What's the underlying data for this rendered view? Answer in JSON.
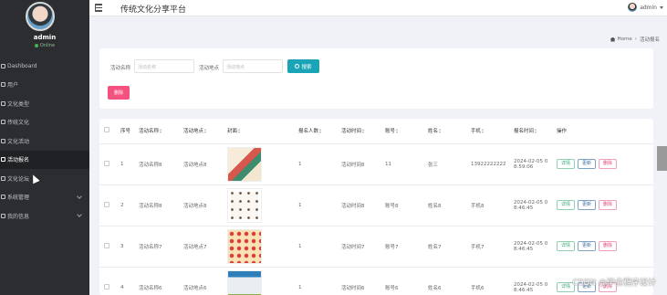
{
  "app_title": "传统文化分享平台",
  "sidebar": {
    "username": "admin",
    "status": "Online",
    "items": [
      {
        "label": "Dashboard",
        "active": false,
        "expandable": false
      },
      {
        "label": "用户",
        "active": false,
        "expandable": false
      },
      {
        "label": "文化类型",
        "active": false,
        "expandable": false
      },
      {
        "label": "传统文化",
        "active": false,
        "expandable": false
      },
      {
        "label": "文化活动",
        "active": false,
        "expandable": false
      },
      {
        "label": "活动报名",
        "active": true,
        "expandable": false
      },
      {
        "label": "文化论坛",
        "active": false,
        "expandable": false
      },
      {
        "label": "系统管理",
        "active": false,
        "expandable": true
      },
      {
        "label": "我的信息",
        "active": false,
        "expandable": true
      }
    ]
  },
  "topbar": {
    "username": "admin"
  },
  "breadcrumb": {
    "home": "Home",
    "current": "活动报名"
  },
  "search": {
    "field1_label": "活动名称",
    "field1_placeholder": "活动名称",
    "field2_label": "活动地点",
    "field2_placeholder": "活动地点",
    "search_label": "搜索",
    "delete_label": "删除"
  },
  "table": {
    "columns": [
      "序号",
      "活动名称",
      "活动地点",
      "封面",
      "报名人数",
      "活动时间",
      "账号",
      "姓名",
      "手机",
      "报名时间",
      "操作"
    ],
    "rows": [
      {
        "index": "1",
        "name": "活动名称8",
        "place": "活动地点8",
        "count": "1",
        "time": "活动时间8",
        "account": "11",
        "person": "张三",
        "phone": "13922222222",
        "signup_l1": "2024-02-05 0",
        "signup_l2": "8:59:06"
      },
      {
        "index": "2",
        "name": "活动名称8",
        "place": "活动地点8",
        "count": "1",
        "time": "活动时间8",
        "account": "账号8",
        "person": "姓名8",
        "phone": "手机8",
        "signup_l1": "2024-02-05 0",
        "signup_l2": "8:46:45"
      },
      {
        "index": "3",
        "name": "活动名称7",
        "place": "活动地点7",
        "count": "1",
        "time": "活动时间7",
        "account": "账号7",
        "person": "姓名7",
        "phone": "手机7",
        "signup_l1": "2024-02-05 0",
        "signup_l2": "8:46:45"
      },
      {
        "index": "4",
        "name": "活动名称6",
        "place": "活动地点6",
        "count": "1",
        "time": "活动时间6",
        "account": "账号6",
        "person": "姓名6",
        "phone": "手机6",
        "signup_l1": "2024-02-05 0",
        "signup_l2": "8:46:45"
      }
    ],
    "actions": {
      "view": "详情",
      "update": "更新",
      "delete": "删除"
    }
  },
  "watermark": "CSDN @毕业程序设计",
  "colors": {
    "sidebar_bg": "#2b2d30",
    "search_button": "#1ba3b7",
    "delete_button": "#f4517f"
  }
}
